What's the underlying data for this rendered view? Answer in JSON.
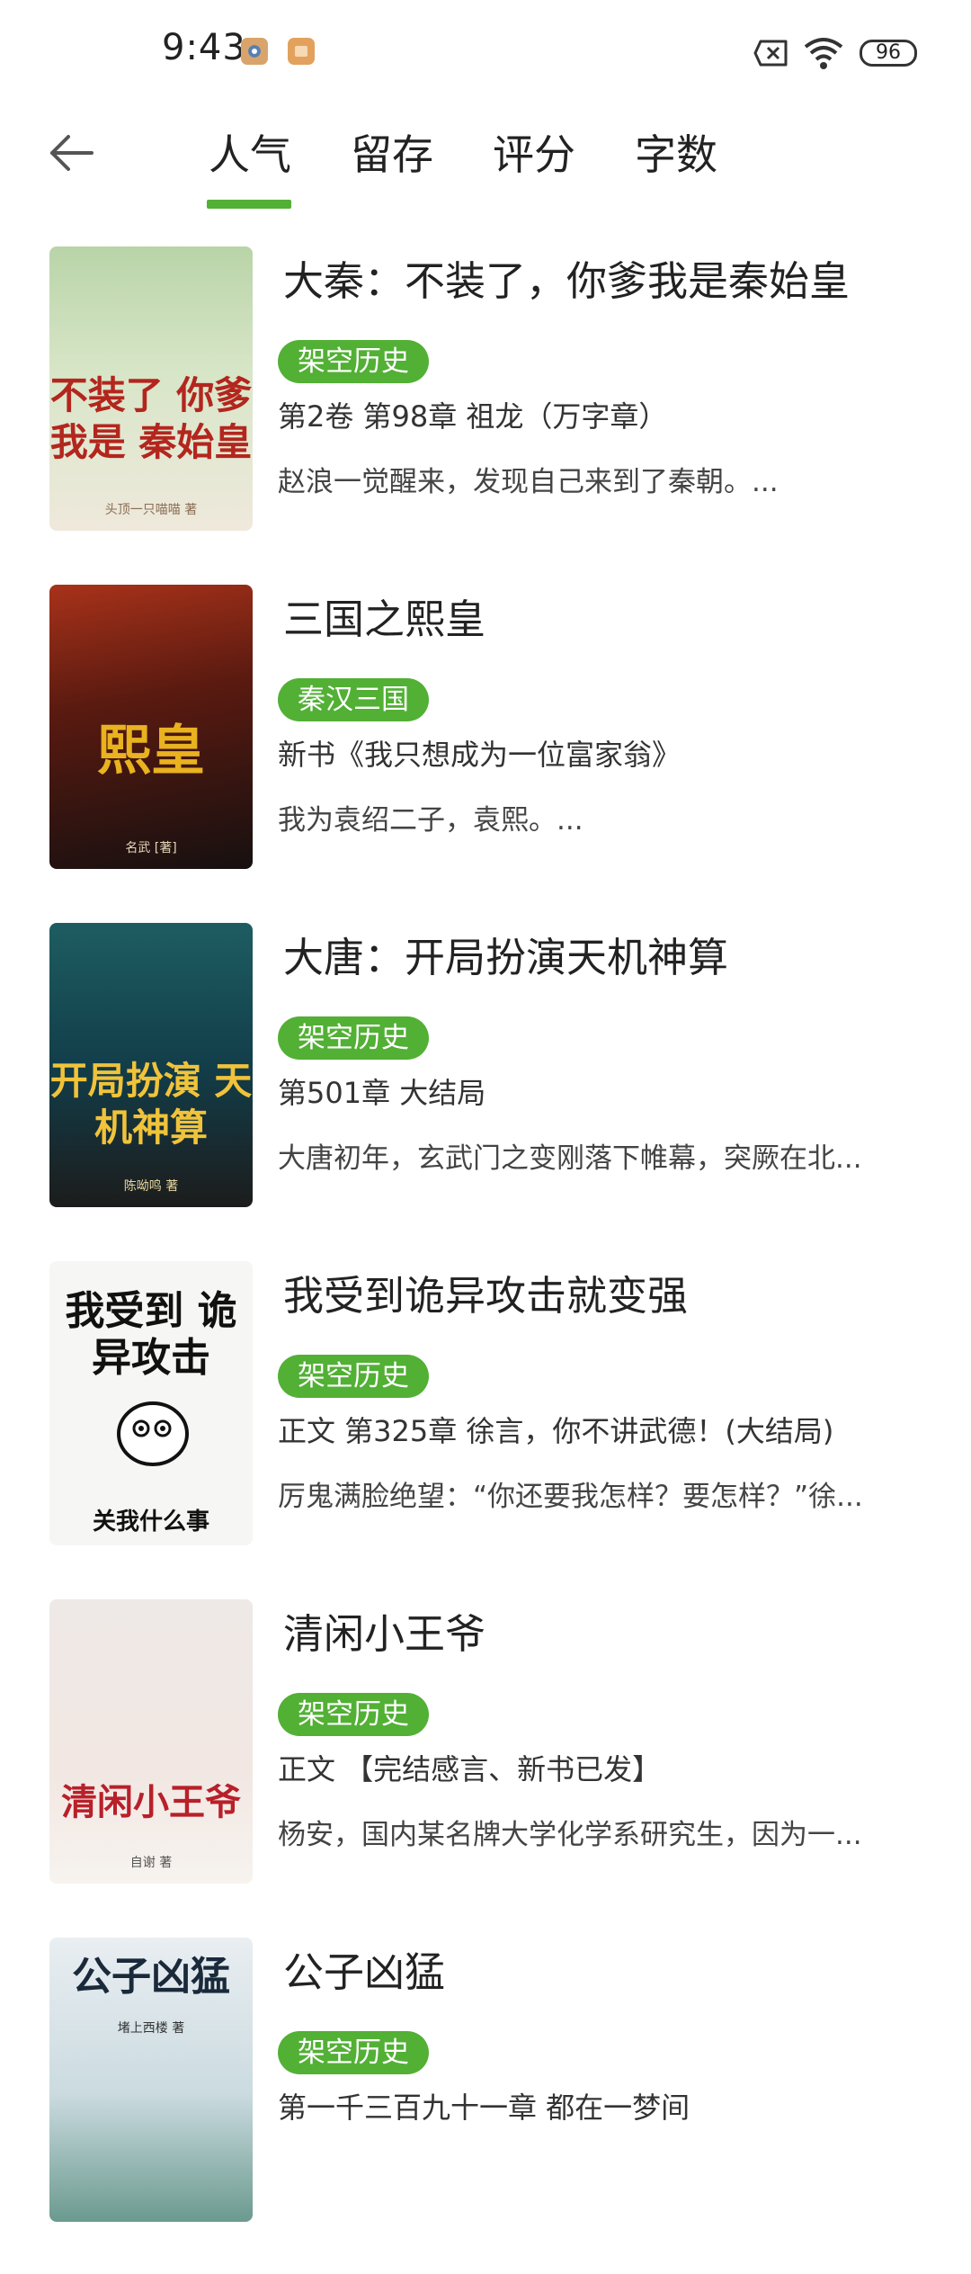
{
  "status_bar": {
    "time": "9:43",
    "battery": "96",
    "icons": [
      "notification-app-icon",
      "notification-shop-icon",
      "no-sim-icon",
      "wifi-icon",
      "battery-icon"
    ]
  },
  "header": {
    "back_icon": "arrow-left-icon",
    "tabs": [
      {
        "label": "人气",
        "active": true
      },
      {
        "label": "留存",
        "active": false
      },
      {
        "label": "评分",
        "active": false
      },
      {
        "label": "字数",
        "active": false
      }
    ],
    "accent_color": "#52b035"
  },
  "books": [
    {
      "title": "大秦：不装了，你爹我是秦始皇",
      "tag": "架空历史",
      "chapter": "第2卷 第98章 祖龙（万字章）",
      "summary": "赵浪一觉醒来，发现自己来到了秦朝。...",
      "cover_text": "不装了 你爹我是 秦始皇",
      "cover_author": "头顶一只喵喵 著"
    },
    {
      "title": "三国之熙皇",
      "tag": "秦汉三国",
      "chapter": "新书《我只想成为一位富家翁》",
      "summary": "我为袁绍二子，袁熙。...",
      "cover_text": "熙皇",
      "cover_author": "名武 [著]"
    },
    {
      "title": "大唐：开局扮演天机神算",
      "tag": "架空历史",
      "chapter": "第501章 大结局",
      "summary": "大唐初年，玄武门之变刚落下帷幕，突厥在北...",
      "cover_text": "开局扮演 天机神算",
      "cover_author": "陈呦鸣 著"
    },
    {
      "title": "我受到诡异攻击就变强",
      "tag": "架空历史",
      "chapter": "正文 第325章 徐言，你不讲武德！(大结局)",
      "summary": "厉鬼满脸绝望：“你还要我怎样？要怎样？”徐...",
      "cover_text": "我受到 诡异攻击",
      "cover_author": "关我什么事"
    },
    {
      "title": "清闲小王爷",
      "tag": "架空历史",
      "chapter": "正文 【完结感言、新书已发】",
      "summary": "杨安，国内某名牌大学化学系研究生，因为一...",
      "cover_text": "清闲小王爷",
      "cover_author": "自谢 著"
    },
    {
      "title": "公子凶猛",
      "tag": "架空历史",
      "chapter": "第一千三百九十一章 都在一梦间",
      "summary": "",
      "cover_text": "公子凶猛",
      "cover_author": "堵上西楼 著"
    }
  ]
}
